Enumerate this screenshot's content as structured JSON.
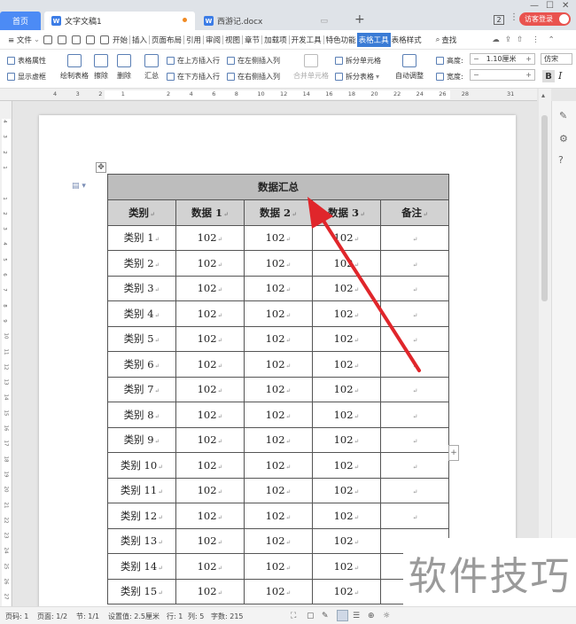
{
  "titlebar": {
    "tabs": [
      {
        "label": "首页"
      },
      {
        "label": "文字文稿1"
      },
      {
        "label": "西游记.docx"
      }
    ],
    "window_count": "2",
    "visitor_label": "访客登录"
  },
  "menu": {
    "file_label": "≡ 文件",
    "items": [
      "开始",
      "插入",
      "页面布局",
      "引用",
      "审阅",
      "视图",
      "章节",
      "加载项",
      "开发工具",
      "特色功能",
      "表格工具",
      "表格样式"
    ],
    "active": "表格工具",
    "search_label": "查找"
  },
  "ribbon": {
    "table_props": "表格属性",
    "show_gridlines": "显示虚框",
    "draw_table": "绘制表格",
    "erase": "擦除",
    "delete": "删除",
    "summary": "汇总",
    "insert_above": "在上方插入行",
    "insert_below": "在下方插入行",
    "insert_left": "在左侧插入列",
    "insert_right": "在右侧插入列",
    "merge_cells": "合并单元格",
    "split_cells": "拆分单元格",
    "split_table": "拆分表格",
    "auto_fit": "自动调整",
    "height_label": "高度:",
    "height_value": "1.10厘米",
    "width_label": "宽度:",
    "font_name": "仿宋",
    "bold": "B",
    "italic": "I"
  },
  "ruler": {
    "h_ticks": [
      "4",
      "3",
      "2",
      "1",
      "",
      "2",
      "4",
      "6",
      "8",
      "10",
      "12",
      "14",
      "16",
      "18",
      "20",
      "22",
      "24",
      "26",
      "28",
      "",
      "31"
    ],
    "v_ticks": [
      "4",
      "3",
      "2",
      "1",
      "",
      "1",
      "2",
      "3",
      "4",
      "5",
      "6",
      "7",
      "8",
      "9",
      "10",
      "11",
      "12",
      "13",
      "14",
      "15",
      "16",
      "17",
      "18",
      "19",
      "20",
      "21",
      "22",
      "23",
      "24",
      "25",
      "26",
      "27"
    ]
  },
  "table": {
    "title": "数据汇总",
    "headers": [
      "类别",
      "数据 1",
      "数据 2",
      "数据 3",
      "备注"
    ],
    "rows": [
      [
        "类别 1",
        "102",
        "102",
        "102",
        ""
      ],
      [
        "类别 2",
        "102",
        "102",
        "102",
        ""
      ],
      [
        "类别 3",
        "102",
        "102",
        "102",
        ""
      ],
      [
        "类别 4",
        "102",
        "102",
        "102",
        ""
      ],
      [
        "类别 5",
        "102",
        "102",
        "102",
        ""
      ],
      [
        "类别 6",
        "102",
        "102",
        "102",
        ""
      ],
      [
        "类别 7",
        "102",
        "102",
        "102",
        ""
      ],
      [
        "类别 8",
        "102",
        "102",
        "102",
        ""
      ],
      [
        "类别 9",
        "102",
        "102",
        "102",
        ""
      ],
      [
        "类别 10",
        "102",
        "102",
        "102",
        ""
      ],
      [
        "类别 11",
        "102",
        "102",
        "102",
        ""
      ],
      [
        "类别 12",
        "102",
        "102",
        "102",
        ""
      ],
      [
        "类别 13",
        "102",
        "102",
        "102",
        ""
      ],
      [
        "类别 14",
        "102",
        "102",
        "102",
        ""
      ],
      [
        "类别 15",
        "102",
        "102",
        "102",
        ""
      ]
    ]
  },
  "status": {
    "page_no": "页码: 1",
    "pages": "页面: 1/2",
    "section": "节: 1/1",
    "setting": "设置值: 2.5厘米",
    "row": "行: 1",
    "col": "列: 5",
    "words": "字数: 215"
  },
  "watermark": "软件技巧",
  "colors": {
    "accent": "#3a7bd5",
    "annotation_arrow": "#e0262b",
    "visitor": "#e9534f"
  }
}
